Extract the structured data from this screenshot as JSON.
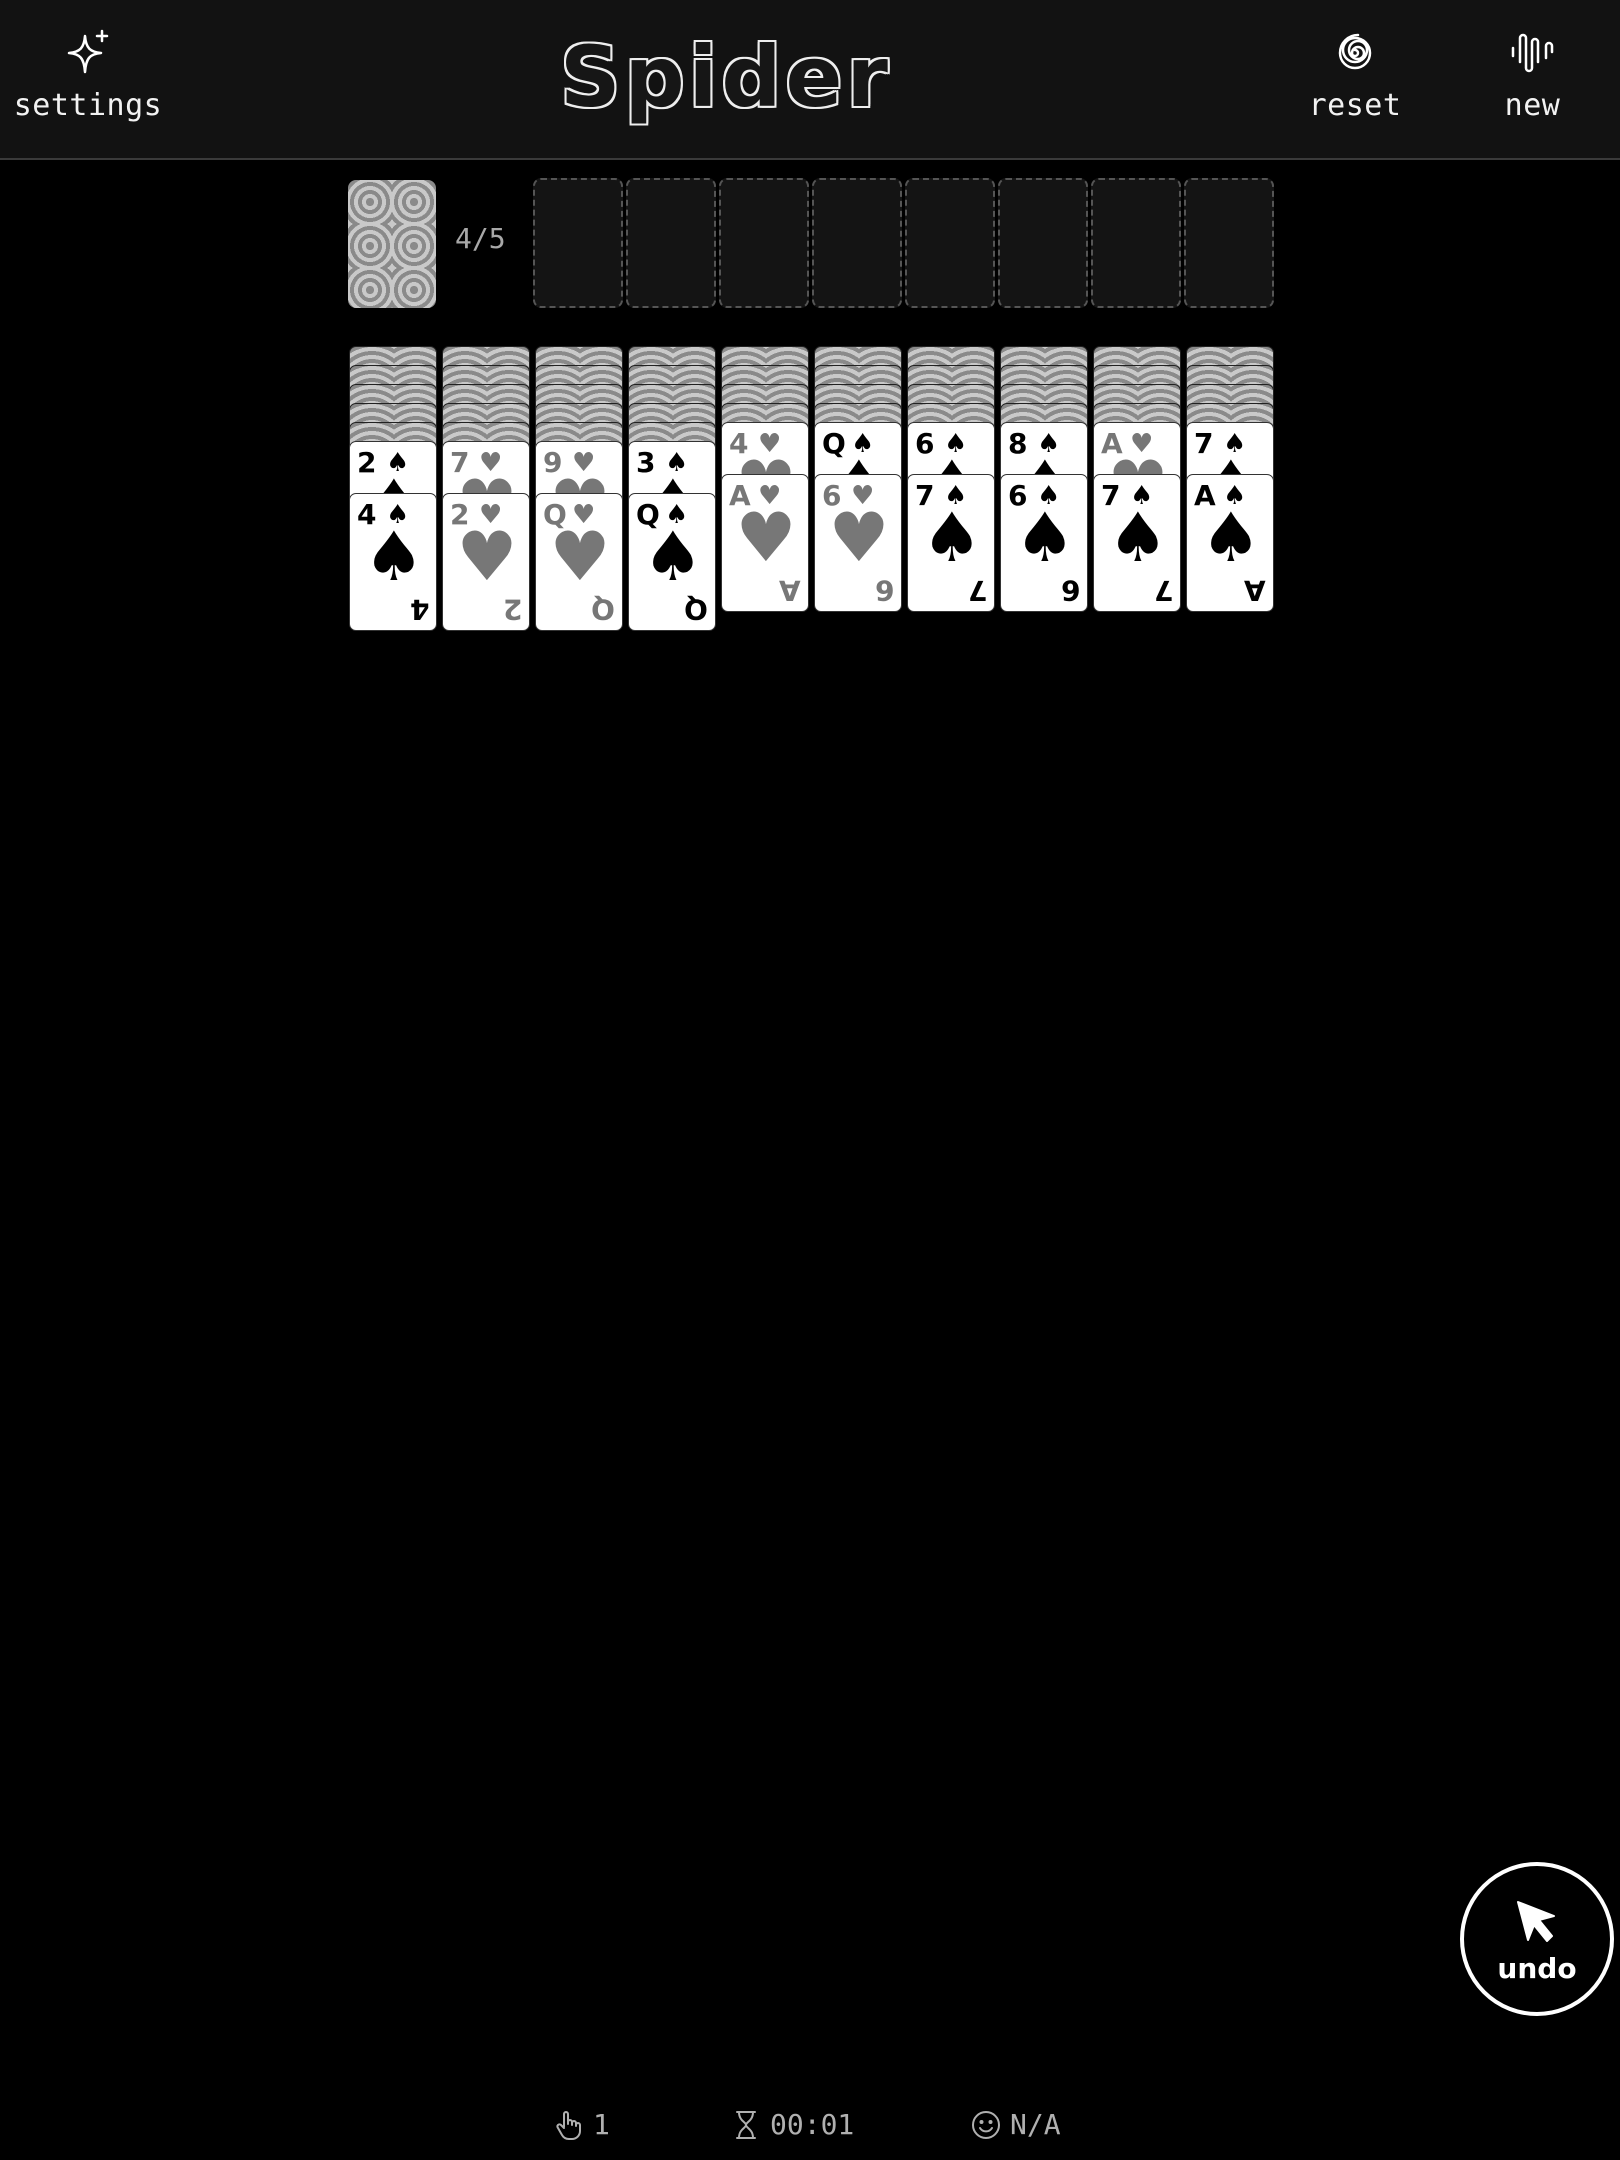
{
  "header": {
    "title": "Spider",
    "settings_label": "settings",
    "reset_label": "reset",
    "new_label": "new",
    "settings_icon": "sparkle-icon",
    "reset_icon": "spiral-icon",
    "new_icon": "waveform-icon"
  },
  "stock": {
    "count_label": "4/5"
  },
  "foundations": {
    "empty_slots": 8
  },
  "tableau": [
    {
      "hidden": 5,
      "cards": [
        {
          "rank": "2",
          "suit": "♠",
          "color": "black"
        },
        {
          "rank": "4",
          "suit": "♠",
          "color": "black"
        }
      ]
    },
    {
      "hidden": 5,
      "cards": [
        {
          "rank": "7",
          "suit": "♥",
          "color": "red"
        },
        {
          "rank": "2",
          "suit": "♥",
          "color": "red"
        }
      ]
    },
    {
      "hidden": 5,
      "cards": [
        {
          "rank": "9",
          "suit": "♥",
          "color": "red"
        },
        {
          "rank": "Q",
          "suit": "♥",
          "color": "red"
        }
      ]
    },
    {
      "hidden": 5,
      "cards": [
        {
          "rank": "3",
          "suit": "♠",
          "color": "black"
        },
        {
          "rank": "Q",
          "suit": "♠",
          "color": "black"
        }
      ]
    },
    {
      "hidden": 4,
      "cards": [
        {
          "rank": "4",
          "suit": "♥",
          "color": "red"
        },
        {
          "rank": "A",
          "suit": "♥",
          "color": "red"
        }
      ]
    },
    {
      "hidden": 4,
      "cards": [
        {
          "rank": "Q",
          "suit": "♠",
          "color": "black"
        },
        {
          "rank": "6",
          "suit": "♥",
          "color": "red"
        }
      ]
    },
    {
      "hidden": 4,
      "cards": [
        {
          "rank": "6",
          "suit": "♠",
          "color": "black"
        },
        {
          "rank": "7",
          "suit": "♠",
          "color": "black"
        }
      ]
    },
    {
      "hidden": 4,
      "cards": [
        {
          "rank": "8",
          "suit": "♠",
          "color": "black"
        },
        {
          "rank": "6",
          "suit": "♠",
          "color": "black"
        }
      ]
    },
    {
      "hidden": 4,
      "cards": [
        {
          "rank": "A",
          "suit": "♥",
          "color": "red"
        },
        {
          "rank": "7",
          "suit": "♠",
          "color": "black"
        }
      ]
    },
    {
      "hidden": 4,
      "cards": [
        {
          "rank": "7",
          "suit": "♠",
          "color": "black"
        },
        {
          "rank": "A",
          "suit": "♠",
          "color": "black"
        }
      ]
    }
  ],
  "undo": {
    "label": "undo",
    "icon": "cursor-arrow-icon"
  },
  "stats": {
    "moves": "1",
    "time": "00:01",
    "score": "N/A",
    "moves_icon": "hand-pointer-icon",
    "time_icon": "hourglass-icon",
    "score_icon": "smiley-icon"
  },
  "colors": {
    "background": "#000000",
    "header": "#121212",
    "red_suit": "#777777",
    "black_suit": "#000000"
  }
}
